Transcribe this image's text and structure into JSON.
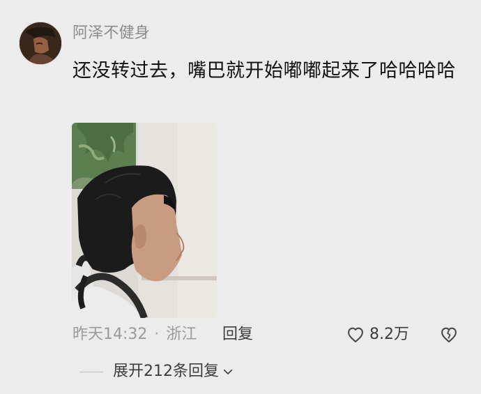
{
  "comment": {
    "username": "阿泽不健身",
    "text": "还没转过去，嘴巴就开始嘟嘟起来了哈哈哈哈",
    "timestamp": "昨天14:32",
    "separator": "·",
    "location": "浙江",
    "reply_label": "回复",
    "like_count": "8.2万",
    "expand_replies_label": "展开212条回复"
  },
  "icons": {
    "like": "heart-outline-icon",
    "dislike": "broken-heart-icon",
    "expand": "chevron-down-icon"
  },
  "colors": {
    "background": "#ececec",
    "username": "#8c8c8c",
    "body_text": "#121212",
    "meta_text": "#9a9a9a",
    "action_text": "#3d3d3d"
  }
}
